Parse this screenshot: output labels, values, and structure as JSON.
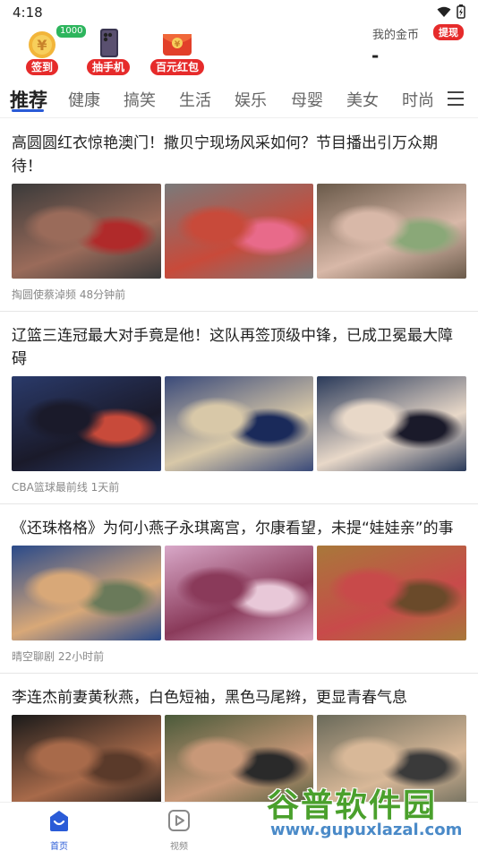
{
  "status": {
    "time": "4:18"
  },
  "header": {
    "promos": [
      {
        "label": "签到",
        "badge": "1000元",
        "icon": "coin-icon"
      },
      {
        "label": "抽手机",
        "icon": "phone-icon"
      },
      {
        "label": "百元红包",
        "icon": "red-envelope-icon"
      }
    ],
    "gold_label": "我的金币",
    "withdraw_label": "提现",
    "gold_value": "-"
  },
  "tabs": [
    "推荐",
    "健康",
    "搞笑",
    "生活",
    "娱乐",
    "母婴",
    "美女",
    "时尚"
  ],
  "articles": [
    {
      "title": "高圆圆红衣惊艳澳门！撒贝宁现场风采如何？节目播出引万众期待！",
      "meta": "掏圆使蔡淖频 48分钟前",
      "thumb_colors": [
        [
          "#3a3a3a",
          "#9a6b5a",
          "#b02a2a"
        ],
        [
          "#7a7a7a",
          "#c84a3a",
          "#e86a8a"
        ],
        [
          "#6a5a4a",
          "#d8b8a8",
          "#8aa878"
        ]
      ]
    },
    {
      "title": "辽篮三连冠最大对手竟是他！这队再签顶级中锋，已成卫冕最大障碍",
      "meta": "CBA篮球最前线 1天前",
      "thumb_colors": [
        [
          "#2a3a6a",
          "#1a1a2a",
          "#c84a3a"
        ],
        [
          "#3a4a7a",
          "#d8c8a8",
          "#1a2a5a"
        ],
        [
          "#2a3a5a",
          "#e8d8c8",
          "#1a1a2a"
        ]
      ]
    },
    {
      "title": "《还珠格格》为何小燕子永琪离宫，尔康看望，未提“娃娃亲”的事",
      "meta": "晴空聊剧 22小时前",
      "thumb_colors": [
        [
          "#2a4a8a",
          "#d8a878",
          "#6a7a5a"
        ],
        [
          "#d8a8c8",
          "#8a3a5a",
          "#e8c8d8"
        ],
        [
          "#a8783a",
          "#c84a4a",
          "#6a4a2a"
        ]
      ]
    },
    {
      "title": "李连杰前妻黄秋燕，白色短袖，黑色马尾辫，更显青春气息",
      "meta": "",
      "thumb_colors": [
        [
          "#1a1a1a",
          "#a86a4a",
          "#5a3a2a"
        ],
        [
          "#4a5a3a",
          "#c89878",
          "#2a2a2a"
        ],
        [
          "#6a6a5a",
          "#d8b898",
          "#3a3a3a"
        ]
      ]
    }
  ],
  "bottom_nav": [
    {
      "label": "首页",
      "icon": "home-icon",
      "active": true
    },
    {
      "label": "视频",
      "icon": "video-icon",
      "active": false
    }
  ],
  "watermark": {
    "text": "谷普软件园",
    "url": "www.gupuxlazal.com"
  },
  "colors": {
    "accent": "#2a5bd7",
    "red": "#e62b2b"
  }
}
